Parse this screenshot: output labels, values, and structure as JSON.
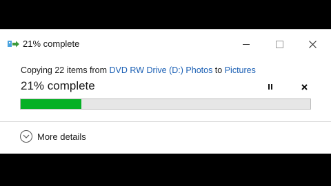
{
  "window": {
    "title": "21% complete"
  },
  "dialog": {
    "copy_prefix": "Copying 22 items from ",
    "source": "DVD RW Drive (D:) Photos",
    "to_word": " to ",
    "destination": "Pictures",
    "progress_text": "21% complete",
    "progress_fraction": 0.21,
    "progress_color": "#06b025",
    "link_color": "#1a5fb4",
    "pause_icon": "pause-icon",
    "cancel_icon": "close-icon"
  },
  "footer": {
    "more_details_label": "More details",
    "more_details_icon": "chevron-down-circle-icon"
  }
}
